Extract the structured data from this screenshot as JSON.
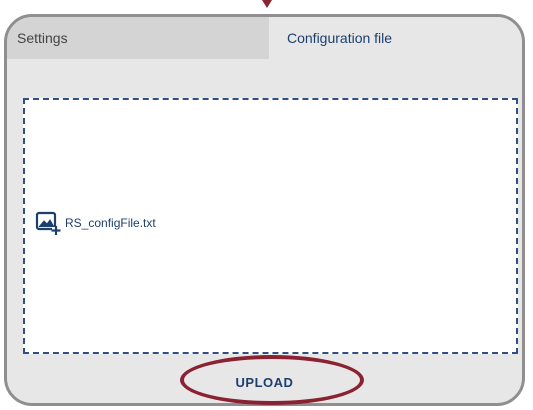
{
  "tabs": {
    "settings_label": "Settings",
    "config_label": "Configuration file"
  },
  "dropzone": {
    "file_name": "RS_configFile.txt",
    "file_icon": "image-add-icon"
  },
  "actions": {
    "upload_label": "UPLOAD"
  },
  "colors": {
    "accent": "#1d3f6e",
    "highlight": "#8a2232",
    "panel_bg": "#e7e7e7",
    "panel_border": "#8f8f8f"
  }
}
